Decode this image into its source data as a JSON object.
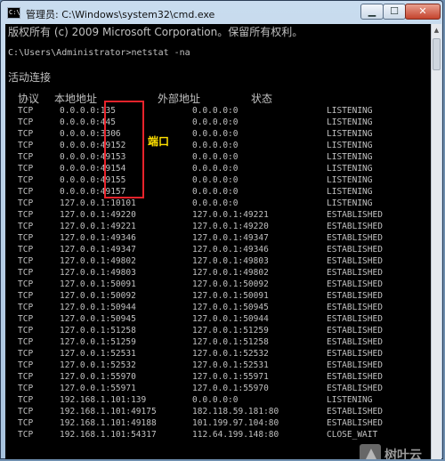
{
  "window": {
    "title": "管理员: C:\\Windows\\system32\\cmd.exe",
    "app_icon_text": "C:\\",
    "minimize_label": "▁",
    "maximize_label": "☐",
    "close_label": "✕"
  },
  "console": {
    "copyright": "版权所有 (c) 2009 Microsoft Corporation。保留所有权利。",
    "prompt": "C:\\Users\\Administrator>netstat -na",
    "section_title": "活动连接",
    "headers": {
      "protocol": "协议",
      "local": "本地地址",
      "foreign": "外部地址",
      "state": "状态"
    },
    "rows": [
      {
        "proto": "TCP",
        "local": "0.0.0.0:135",
        "foreign": "0.0.0.0:0",
        "state": "LISTENING"
      },
      {
        "proto": "TCP",
        "local": "0.0.0.0:445",
        "foreign": "0.0.0.0:0",
        "state": "LISTENING"
      },
      {
        "proto": "TCP",
        "local": "0.0.0.0:3306",
        "foreign": "0.0.0.0:0",
        "state": "LISTENING"
      },
      {
        "proto": "TCP",
        "local": "0.0.0.0:49152",
        "foreign": "0.0.0.0:0",
        "state": "LISTENING"
      },
      {
        "proto": "TCP",
        "local": "0.0.0.0:49153",
        "foreign": "0.0.0.0:0",
        "state": "LISTENING"
      },
      {
        "proto": "TCP",
        "local": "0.0.0.0:49154",
        "foreign": "0.0.0.0:0",
        "state": "LISTENING"
      },
      {
        "proto": "TCP",
        "local": "0.0.0.0:49155",
        "foreign": "0.0.0.0:0",
        "state": "LISTENING"
      },
      {
        "proto": "TCP",
        "local": "0.0.0.0:49157",
        "foreign": "0.0.0.0:0",
        "state": "LISTENING"
      },
      {
        "proto": "TCP",
        "local": "127.0.0.1:10101",
        "foreign": "0.0.0.0:0",
        "state": "LISTENING"
      },
      {
        "proto": "TCP",
        "local": "127.0.0.1:49220",
        "foreign": "127.0.0.1:49221",
        "state": "ESTABLISHED"
      },
      {
        "proto": "TCP",
        "local": "127.0.0.1:49221",
        "foreign": "127.0.0.1:49220",
        "state": "ESTABLISHED"
      },
      {
        "proto": "TCP",
        "local": "127.0.0.1:49346",
        "foreign": "127.0.0.1:49347",
        "state": "ESTABLISHED"
      },
      {
        "proto": "TCP",
        "local": "127.0.0.1:49347",
        "foreign": "127.0.0.1:49346",
        "state": "ESTABLISHED"
      },
      {
        "proto": "TCP",
        "local": "127.0.0.1:49802",
        "foreign": "127.0.0.1:49803",
        "state": "ESTABLISHED"
      },
      {
        "proto": "TCP",
        "local": "127.0.0.1:49803",
        "foreign": "127.0.0.1:49802",
        "state": "ESTABLISHED"
      },
      {
        "proto": "TCP",
        "local": "127.0.0.1:50091",
        "foreign": "127.0.0.1:50092",
        "state": "ESTABLISHED"
      },
      {
        "proto": "TCP",
        "local": "127.0.0.1:50092",
        "foreign": "127.0.0.1:50091",
        "state": "ESTABLISHED"
      },
      {
        "proto": "TCP",
        "local": "127.0.0.1:50944",
        "foreign": "127.0.0.1:50945",
        "state": "ESTABLISHED"
      },
      {
        "proto": "TCP",
        "local": "127.0.0.1:50945",
        "foreign": "127.0.0.1:50944",
        "state": "ESTABLISHED"
      },
      {
        "proto": "TCP",
        "local": "127.0.0.1:51258",
        "foreign": "127.0.0.1:51259",
        "state": "ESTABLISHED"
      },
      {
        "proto": "TCP",
        "local": "127.0.0.1:51259",
        "foreign": "127.0.0.1:51258",
        "state": "ESTABLISHED"
      },
      {
        "proto": "TCP",
        "local": "127.0.0.1:52531",
        "foreign": "127.0.0.1:52532",
        "state": "ESTABLISHED"
      },
      {
        "proto": "TCP",
        "local": "127.0.0.1:52532",
        "foreign": "127.0.0.1:52531",
        "state": "ESTABLISHED"
      },
      {
        "proto": "TCP",
        "local": "127.0.0.1:55970",
        "foreign": "127.0.0.1:55971",
        "state": "ESTABLISHED"
      },
      {
        "proto": "TCP",
        "local": "127.0.0.1:55971",
        "foreign": "127.0.0.1:55970",
        "state": "ESTABLISHED"
      },
      {
        "proto": "TCP",
        "local": "192.168.1.101:139",
        "foreign": "0.0.0.0:0",
        "state": "LISTENING"
      },
      {
        "proto": "TCP",
        "local": "192.168.1.101:49175",
        "foreign": "182.118.59.181:80",
        "state": "ESTABLISHED"
      },
      {
        "proto": "TCP",
        "local": "192.168.1.101:49188",
        "foreign": "101.199.97.104:80",
        "state": "ESTABLISHED"
      },
      {
        "proto": "TCP",
        "local": "192.168.1.101:54317",
        "foreign": "112.64.199.148:80",
        "state": "CLOSE_WAIT"
      }
    ]
  },
  "annotation": {
    "label": "端口",
    "color": "#e8232b",
    "text_color": "#ffe000"
  },
  "watermark": {
    "text": "树叶云"
  }
}
